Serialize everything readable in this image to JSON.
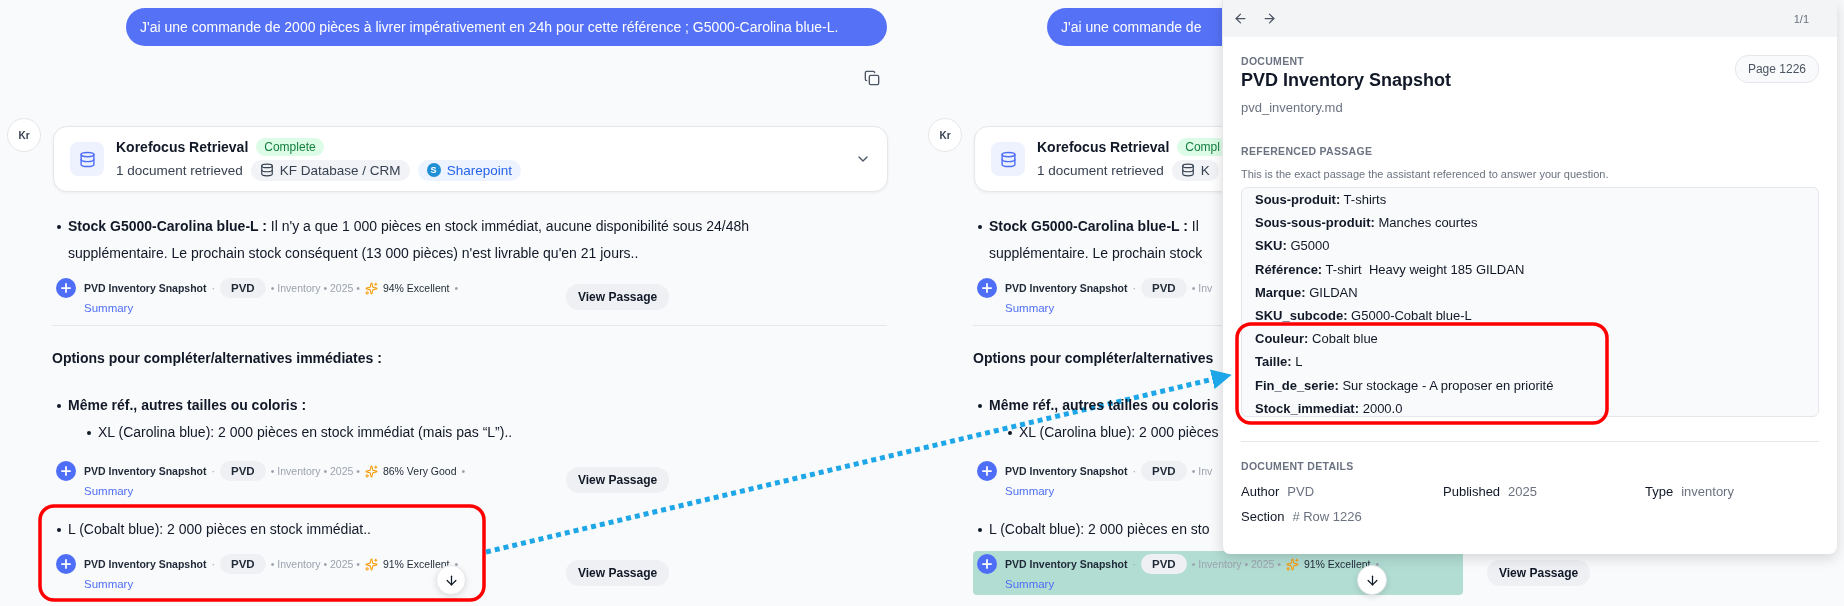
{
  "panels": [
    {
      "user_message": "J'ai une commande de 2000 pièces à livrer impérativement en 24h pour cette référence ; G5000-Carolina blue-L.",
      "copy_button": true,
      "avatar": "Kr",
      "retrieval": {
        "title": "Korefocus Retrieval",
        "status": "Complete",
        "summary": "1 document retrieved",
        "expanded": false,
        "sources": [
          {
            "kind": "database",
            "label": "KF Database / CRM"
          },
          {
            "kind": "sharepoint",
            "badge": "S",
            "label": "Sharepoint"
          }
        ]
      },
      "blocks": [
        {
          "kind": "bullet",
          "lines": [
            "**Stock G5000-Carolina blue-L :** Il n'y a que 1 000 pièces en stock immédiat, aucune disponibilité sous 24/48h",
            "supplémentaire. Le prochain stock conséquent (13 000 pièces) n'est livrable qu'en 21 jours.."
          ]
        },
        {
          "kind": "citation",
          "title": "PVD Inventory Snapshot",
          "separator": "·",
          "tag": "PVD",
          "meta": "• Inventory • 2025 •",
          "score": "94% Excellent",
          "end": "•",
          "link": "Summary",
          "highlighted": false,
          "button": "View Passage"
        },
        {
          "kind": "divider"
        },
        {
          "kind": "heading",
          "text": "Options pour compléter/alternatives immédiates :"
        },
        {
          "kind": "bullet_heading",
          "lines": [
            "Même réf., autres tailles ou coloris :"
          ]
        },
        {
          "kind": "sub_bullet",
          "lines": [
            "XL (Carolina blue): 2 000 pièces en stock immédiat (mais pas “L”).."
          ]
        },
        {
          "kind": "citation",
          "title": "PVD Inventory Snapshot",
          "separator": "·",
          "tag": "PVD",
          "meta": "• Inventory • 2025 •",
          "score": "86% Very Good",
          "end": "•",
          "link": "Summary",
          "highlighted": false,
          "button": "View Passage"
        },
        {
          "kind": "bullet",
          "lines": [
            "L (Cobalt blue): 2 000 pièces en stock immédiat.."
          ]
        },
        {
          "kind": "citation",
          "title": "PVD Inventory Snapshot",
          "separator": "·",
          "tag": "PVD",
          "meta": "• Inventory • 2025 •",
          "score": "91% Excellent",
          "end": "•",
          "link": "Summary",
          "highlighted": false,
          "button": "View Passage"
        }
      ]
    },
    {
      "user_message": "J'ai une commande de",
      "copy_button": false,
      "avatar": "Kr",
      "retrieval": {
        "title": "Korefocus Retrieval",
        "status": "Compl",
        "summary": "1 document retrieved",
        "sources": [
          {
            "kind": "database",
            "label": "K"
          }
        ]
      },
      "blocks": [
        {
          "kind": "bullet",
          "lines": [
            "**Stock G5000-Carolina blue-L :** Il",
            "supplémentaire. Le prochain stock"
          ]
        },
        {
          "kind": "citation",
          "title": "PVD Inventory Snapshot",
          "separator": "·",
          "tag": "PVD",
          "meta": "• Inv",
          "link": "Summary",
          "highlighted": false
        },
        {
          "kind": "divider"
        },
        {
          "kind": "heading",
          "text": "Options pour compléter/alternatives"
        },
        {
          "kind": "bullet_heading",
          "lines": [
            "Même réf., autres tailles ou coloris"
          ]
        },
        {
          "kind": "sub_bullet",
          "lines": [
            "XL (Carolina blue): 2 000 pièces"
          ]
        },
        {
          "kind": "citation",
          "title": "PVD Inventory Snapshot",
          "separator": "·",
          "tag": "PVD",
          "meta": "• Inv",
          "link": "Summary",
          "highlighted": false
        },
        {
          "kind": "bullet",
          "lines": [
            "L (Cobalt blue): 2 000 pièces en sto"
          ]
        },
        {
          "kind": "citation",
          "title": "PVD Inventory Snapshot",
          "separator": "·",
          "tag": "PVD",
          "meta": "• Inventory • 2025 •",
          "score": "91% Excellent",
          "end": "•",
          "link": "Summary",
          "highlighted": true,
          "button": "View Passage"
        }
      ]
    }
  ],
  "passage_panel": {
    "counter": "1/1",
    "label": "DOCUMENT",
    "title": "PVD Inventory Snapshot",
    "filename": "pvd_inventory.md",
    "page": "Page 1226",
    "passage_label": "REFERENCED PASSAGE",
    "passage_hint": "This is the exact passage the assistant referenced to answer your question.",
    "passage": [
      {
        "key": "Sous-produit:",
        "value": "T-shirts"
      },
      {
        "key": "Sous-sous-produit:",
        "value": "Manches courtes"
      },
      {
        "key": "SKU:",
        "value": "G5000"
      },
      {
        "key": "Référence:",
        "value": "T-shirt  Heavy weight 185 GILDAN"
      },
      {
        "key": "Marque:",
        "value": "GILDAN"
      },
      {
        "key": "SKU_subcode:",
        "value": "G5000-Cobalt blue-L"
      },
      {
        "key": "Couleur:",
        "value": "Cobalt blue"
      },
      {
        "key": "Taille:",
        "value": "L"
      },
      {
        "key": "Fin_de_serie:",
        "value": "Sur stockage - A proposer en priorité"
      },
      {
        "key": "Stock_immediat:",
        "value": "2000.0"
      }
    ],
    "details_label": "DOCUMENT DETAILS",
    "details": [
      {
        "key": "Author",
        "value": "PVD"
      },
      {
        "key": "Published",
        "value": "2025"
      },
      {
        "key": "Type",
        "value": "inventory"
      },
      {
        "key": "Section",
        "value": "# Row 1226"
      }
    ]
  }
}
